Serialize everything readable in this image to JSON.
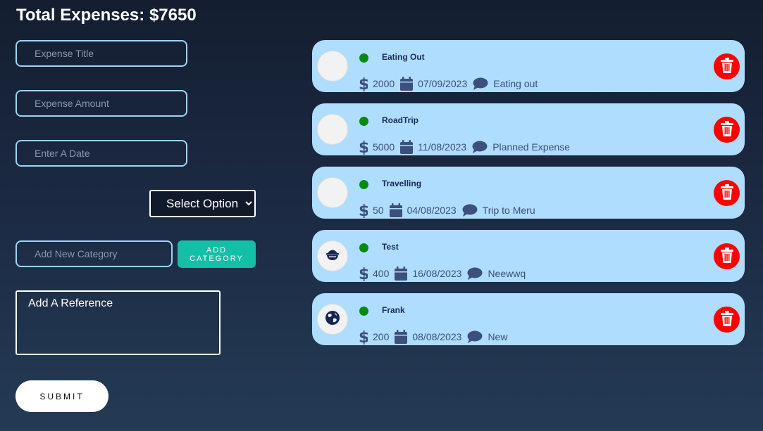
{
  "header": {
    "total_label": "Total Expenses: $7650"
  },
  "form": {
    "title_placeholder": "Expense Title",
    "amount_placeholder": "Expense Amount",
    "date_placeholder": "Enter A Date",
    "select_option": "Select Option",
    "category_placeholder": "Add New Category",
    "add_category_label": "ADD CATEGORY",
    "reference_placeholder": "Add A Reference",
    "submit_label": "SUBMIT"
  },
  "colors": {
    "card_bg": "#aeddfd",
    "delete": "#ff0000",
    "status_dot": "#078a12",
    "accent": "#13bfa6"
  },
  "expenses": [
    {
      "title": "Eating Out",
      "amount": "2000",
      "date": "07/09/2023",
      "note": "Eating out",
      "icon": ""
    },
    {
      "title": "RoadTrip",
      "amount": "5000",
      "date": "11/08/2023",
      "note": "Planned Expense",
      "icon": ""
    },
    {
      "title": "Travelling",
      "amount": "50",
      "date": "04/08/2023",
      "note": "Trip to Meru",
      "icon": ""
    },
    {
      "title": "Test",
      "amount": "400",
      "date": "16/08/2023",
      "note": "Neewwq",
      "icon": "bowl-icon"
    },
    {
      "title": "Frank",
      "amount": "200",
      "date": "08/08/2023",
      "note": "New",
      "icon": "globe-icon"
    }
  ]
}
